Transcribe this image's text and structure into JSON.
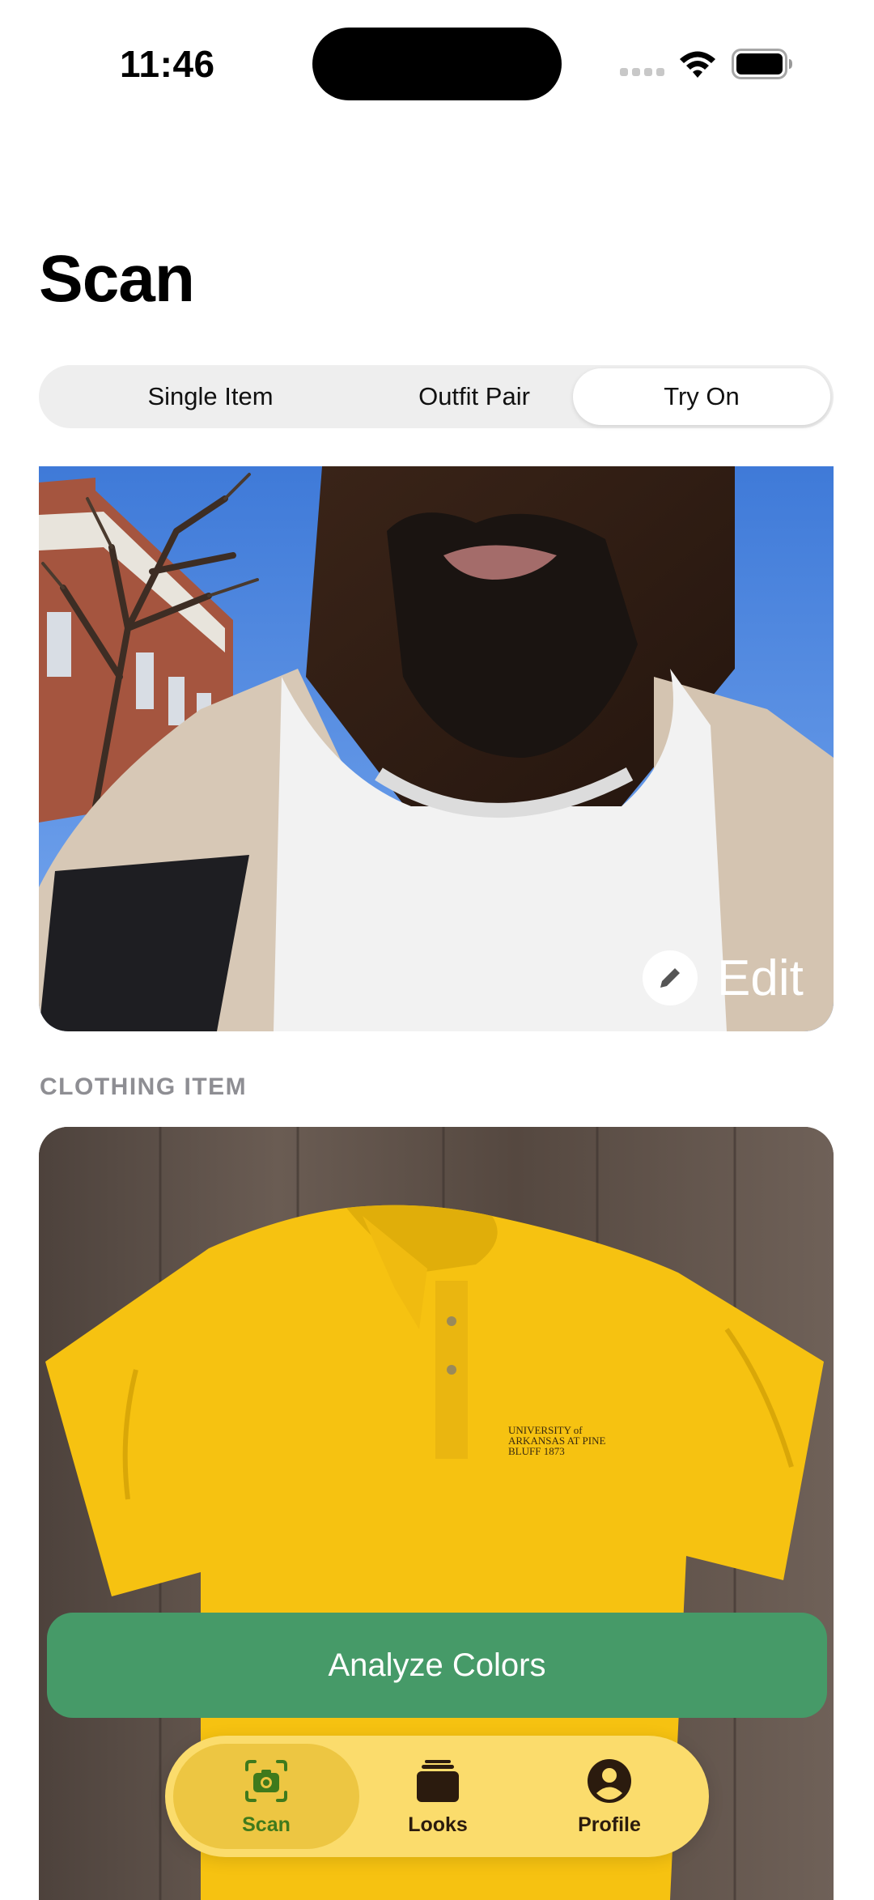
{
  "status_bar": {
    "time": "11:46"
  },
  "page": {
    "title": "Scan"
  },
  "segmented_control": {
    "options": [
      "Single Item",
      "Outfit Pair",
      "Try On"
    ],
    "selected": "Try On"
  },
  "photo_card": {
    "edit_label": "Edit"
  },
  "clothing_section": {
    "label": "CLOTHING ITEM",
    "shirt_logo_text": "UNIVERSITY of ARKANSAS AT PINE BLUFF 1873"
  },
  "actions": {
    "analyze_label": "Analyze Colors"
  },
  "tab_bar": {
    "tabs": [
      {
        "label": "Scan",
        "icon": "camera-icon",
        "selected": true
      },
      {
        "label": "Looks",
        "icon": "stack-icon",
        "selected": false
      },
      {
        "label": "Profile",
        "icon": "person-icon",
        "selected": false
      }
    ]
  },
  "colors": {
    "accent_green": "#469a68",
    "tab_bar_yellow": "#fbdc6c",
    "tab_selected_yellow": "#edc642",
    "tab_selected_green": "#3f7a1c"
  }
}
